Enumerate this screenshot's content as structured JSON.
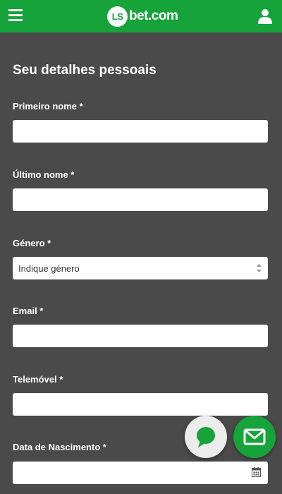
{
  "header": {
    "logo_badge": "LS",
    "logo_text": "bet.com",
    "menu_icon": "hamburger-menu-icon",
    "user_icon": "user-icon",
    "color": "#16a33a"
  },
  "form": {
    "title": "Seu detalhes pessoais",
    "first_name_label": "Primeiro nome *",
    "last_name_label": "Último nome *",
    "gender_label": "Género *",
    "gender_value": "Indique género",
    "email_label": "Email *",
    "phone_label": "Telemóvel *",
    "birthdate_label": "Data de Nascimento *"
  },
  "floating": {
    "chat_icon": "chat-bubble-icon",
    "mail_icon": "envelope-icon"
  }
}
